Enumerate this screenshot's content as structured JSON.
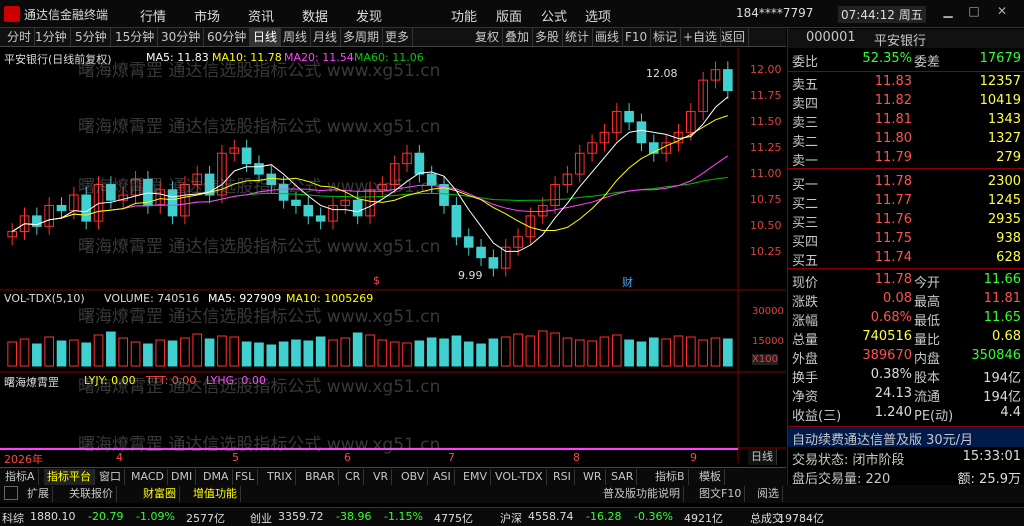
{
  "app": {
    "name": "通达信金融终端",
    "menus": [
      "行情",
      "市场",
      "资讯",
      "数据",
      "发现",
      "功能",
      "版面",
      "公式",
      "选项"
    ],
    "user": "184****7797",
    "time": "07:44:12 周五"
  },
  "toolbar": [
    "分时",
    "1分钟",
    "5分钟",
    "15分钟",
    "30分钟",
    "60分钟",
    "日线",
    "周线",
    "月线",
    "多周期",
    "更多",
    "复权",
    "叠加",
    "多股",
    "统计",
    "画线",
    "F10",
    "标记",
    "+自选",
    "返回"
  ],
  "chart": {
    "header": {
      "name": "平安银行(日线前复权)",
      "ma5": "MA5: 11.83",
      "ma10": "MA10: 11.78",
      "ma20": "MA20: 11.54",
      "ma60": "MA60: 11.06"
    },
    "high_marker": "12.08",
    "low_marker": "9.99",
    "vol_header": {
      "name": "VOL-TDX(5,10)",
      "vol": "VOLUME: 740516",
      "ma5": "MA5: 927909",
      "ma10": "MA10: 1005269"
    },
    "ind_header": {
      "name": "曙海燎霄罡",
      "lyjy": "LYJY: 0.00",
      "ttt": "TTT: 0.00",
      "lyhg": "LYHG: 0.00"
    },
    "price_ticks": [
      "12.00",
      "11.75",
      "11.50",
      "11.25",
      "11.00",
      "10.75",
      "10.50",
      "10.25"
    ],
    "vol_ticks": [
      "30000",
      "15000",
      "X100"
    ],
    "dates": [
      "2026年",
      "4",
      "5",
      "6",
      "7",
      "8",
      "9"
    ],
    "markers": {
      "s": "$",
      "cai": "财"
    },
    "watermark": "曙海燎霄罡 通达信选股指标公式 www.xg51.cn"
  },
  "chart_data": {
    "type": "candlestick",
    "ylim": [
      9.9,
      12.15
    ],
    "ma_colors": {
      "ma5": "#ffffff",
      "ma10": "#ffff00",
      "ma20": "#ff40ff",
      "ma60": "#00c000"
    },
    "close": [
      10.45,
      10.6,
      10.5,
      10.7,
      10.65,
      10.8,
      10.55,
      10.9,
      10.75,
      10.8,
      10.95,
      10.7,
      10.85,
      10.6,
      10.9,
      11.0,
      10.8,
      11.2,
      11.25,
      11.1,
      11.0,
      10.9,
      10.75,
      10.7,
      10.6,
      10.55,
      10.7,
      10.75,
      10.6,
      10.85,
      10.9,
      11.1,
      11.2,
      11.0,
      10.9,
      10.7,
      10.4,
      10.3,
      10.2,
      10.1,
      10.3,
      10.4,
      10.6,
      10.7,
      10.9,
      11.0,
      11.2,
      11.3,
      11.4,
      11.6,
      11.5,
      11.3,
      11.2,
      11.3,
      11.4,
      11.6,
      11.9,
      12.0,
      11.8
    ],
    "volumes": [
      12000,
      13500,
      11000,
      14500,
      12500,
      13000,
      11500,
      15500,
      17000,
      14000,
      12000,
      11000,
      13000,
      12500,
      14000,
      16000,
      13500,
      15000,
      14500,
      12000,
      11500,
      10500,
      12000,
      13000,
      12500,
      14500,
      13000,
      14000,
      16500,
      15500,
      13000,
      12000,
      11500,
      12500,
      14000,
      13500,
      15000,
      12000,
      11000,
      13500,
      14500,
      16000,
      15000,
      17500,
      16500,
      14000,
      13000,
      12500,
      14500,
      15500,
      13000,
      12000,
      14000,
      13500,
      15000,
      14500,
      13000,
      14000,
      13500
    ]
  },
  "quote": {
    "code": "000001",
    "name": "平安银行",
    "weibi": "委比",
    "weibi_v": "52.35%",
    "weicha": "委差",
    "weicha_v": "17679",
    "sells": [
      {
        "l": "卖五",
        "p": "11.83",
        "v": "12357"
      },
      {
        "l": "卖四",
        "p": "11.82",
        "v": "10419"
      },
      {
        "l": "卖三",
        "p": "11.81",
        "v": "1343"
      },
      {
        "l": "卖二",
        "p": "11.80",
        "v": "1327"
      },
      {
        "l": "卖一",
        "p": "11.79",
        "v": "279"
      }
    ],
    "buys": [
      {
        "l": "买一",
        "p": "11.78",
        "v": "2300"
      },
      {
        "l": "买二",
        "p": "11.77",
        "v": "1245"
      },
      {
        "l": "买三",
        "p": "11.76",
        "v": "2935"
      },
      {
        "l": "买四",
        "p": "11.75",
        "v": "938"
      },
      {
        "l": "买五",
        "p": "11.74",
        "v": "628"
      }
    ],
    "stats": [
      {
        "l": "现价",
        "v": "11.78",
        "l2": "今开",
        "v2": "11.66",
        "c": "red",
        "c2": "green"
      },
      {
        "l": "涨跌",
        "v": "0.08",
        "l2": "最高",
        "v2": "11.81",
        "c": "red",
        "c2": "red"
      },
      {
        "l": "涨幅",
        "v": "0.68%",
        "l2": "最低",
        "v2": "11.65",
        "c": "red",
        "c2": "green"
      },
      {
        "l": "总量",
        "v": "740516",
        "l2": "量比",
        "v2": "0.68",
        "c": "yellow",
        "c2": "yellow"
      },
      {
        "l": "外盘",
        "v": "389670",
        "l2": "内盘",
        "v2": "350846",
        "c": "red",
        "c2": "green"
      },
      {
        "l": "换手",
        "v": "0.38%",
        "l2": "股本",
        "v2": "194亿",
        "c": "white",
        "c2": "white"
      },
      {
        "l": "净资",
        "v": "24.13",
        "l2": "流通",
        "v2": "194亿",
        "c": "white",
        "c2": "white"
      },
      {
        "l": "收益(三)",
        "v": "1.240",
        "l2": "PE(动)",
        "v2": "4.4",
        "c": "white",
        "c2": "white"
      }
    ],
    "promo": "自动续费通达信普及版 30元/月",
    "trade_status": "交易状态: 闭市阶段",
    "trade_time": "15:33:01",
    "after_hours": "盘后交易量: 220",
    "after_amount": "额: 25.9万"
  },
  "bottom_tabs": [
    "指标A",
    "指标平台",
    "窗口",
    "MACD",
    "DMI",
    "DMA",
    "FSL",
    "TRIX",
    "BRAR",
    "CR",
    "VR",
    "OBV",
    "ASI",
    "EMV",
    "VOL-TDX",
    "RSI",
    "WR",
    "SAR",
    "指标B",
    "模板"
  ],
  "bottom2": {
    "left": [
      "扩展",
      "关联报价",
      "财富圈",
      "增值功能"
    ],
    "right": [
      "普及版功能说明",
      "图文F10",
      "阅选"
    ],
    "period": "日线"
  },
  "status": [
    {
      "n": "科综",
      "v": "1880.10",
      "d": "-20.79",
      "p": "-1.09%",
      "a": "2577亿"
    },
    {
      "n": "创业",
      "v": "3359.72",
      "d": "-38.96",
      "p": "-1.15%",
      "a": "4775亿"
    },
    {
      "n": "沪深",
      "v": "4558.74",
      "d": "-16.28",
      "p": "-0.36%",
      "a": "4921亿"
    },
    {
      "n": "总成交",
      "v": "19784亿",
      "d": "",
      "p": "",
      "a": ""
    }
  ]
}
